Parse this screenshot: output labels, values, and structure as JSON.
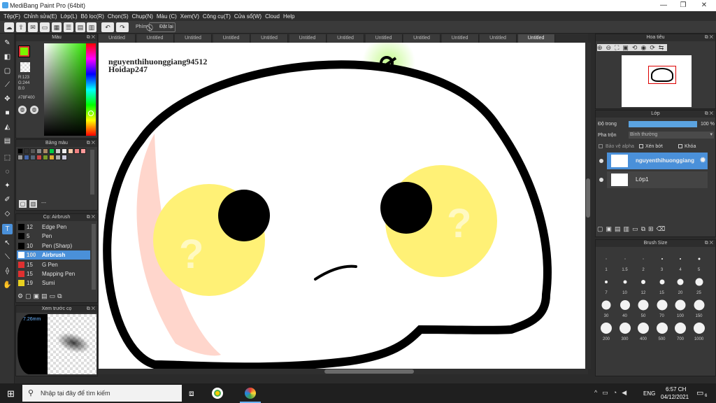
{
  "window": {
    "title": "MediBang Paint Pro (64bit)",
    "controls": [
      "—",
      "❐",
      "✕"
    ]
  },
  "menu": [
    "Tệp(F)",
    "Chỉnh sửa(E)",
    "Lớp(L)",
    "Bộ lọc(R)",
    "Chọn(S)",
    "Chụp(N)",
    "Màu (C)",
    "Xem(V)",
    "Công cụ(T)",
    "Cửa sổ(W)",
    "Cloud",
    "Help"
  ],
  "toolbar": {
    "phim_label": "Phím",
    "reset_label": "Đặt lại"
  },
  "color_panel": {
    "title": "Màu",
    "rgb": [
      "R:123",
      "G:244",
      "B:0"
    ],
    "hex": "#78F400",
    "fg_color": "#7bf400",
    "bg_color": "#ffffff"
  },
  "palette_panel": {
    "title": "Bảng màu",
    "colors": [
      "#000000",
      "#333333",
      "#555555",
      "#888888",
      "#aa8866",
      "#00cc44",
      "#cccccc",
      "#eeeeee",
      "#f6c9a8",
      "#f08080",
      "#ff9999",
      "#999999",
      "#4466aa",
      "#556677",
      "#cc4444",
      "#7a9a2a",
      "#ddaa33",
      "#aaaaaa",
      "#ccccdd"
    ],
    "footer_text": "---"
  },
  "brush_panel": {
    "title": "Cọ: Airbrush",
    "items": [
      {
        "size": "12",
        "name": "Edge Pen",
        "color": "#000000"
      },
      {
        "size": "5",
        "name": "Pen",
        "color": "#000000"
      },
      {
        "size": "10",
        "name": "Pen (Sharp)",
        "color": "#000000"
      },
      {
        "size": "100",
        "name": "Airbrush",
        "color": "#ffffff"
      },
      {
        "size": "15",
        "name": "G Pen",
        "color": "#e03030"
      },
      {
        "size": "15",
        "name": "Mapping Pen",
        "color": "#e03030"
      },
      {
        "size": "19",
        "name": "Sumi",
        "color": "#e8d020"
      }
    ]
  },
  "preview_panel": {
    "title": "Xem trước cọ",
    "size_text": "7.26mm"
  },
  "tabs": [
    "Untitled",
    "Untitled",
    "Untitled",
    "Untitled",
    "Untitled",
    "Untitled",
    "Untitled",
    "Untitled",
    "Untitled",
    "Untitled",
    "Untitled",
    "Untitled"
  ],
  "canvas": {
    "text_line1": "nguyenthihuonggiang94512",
    "text_line2": "Hoidap247"
  },
  "navigator_panel": {
    "title": "Hoa tiêu"
  },
  "layer_panel": {
    "title": "Lớp",
    "opacity_label": "Độ trong",
    "opacity_value": "100 %",
    "blend_label": "Pha trộn",
    "blend_value": "Bình thường",
    "protect_alpha": "Bảo vệ alpha",
    "clipping": "Xén bớt",
    "lock": "Khóa",
    "layers": [
      {
        "name": "nguyenthihuonggiang",
        "selected": true
      },
      {
        "name": "Lớp1",
        "selected": false
      }
    ]
  },
  "brush_size_panel": {
    "title": "Brush Size",
    "sizes": [
      "1",
      "1.5",
      "2",
      "3",
      "4",
      "5",
      "7",
      "10",
      "12",
      "15",
      "20",
      "25",
      "30",
      "40",
      "50",
      "70",
      "100",
      "150",
      "200",
      "300",
      "400",
      "500",
      "700",
      "1000"
    ]
  },
  "taskbar": {
    "search_placeholder": "Nhập tại đây để tìm kiếm",
    "lang": "ENG",
    "time": "6:57 CH",
    "date": "04/12/2021",
    "notif_count": "6"
  }
}
